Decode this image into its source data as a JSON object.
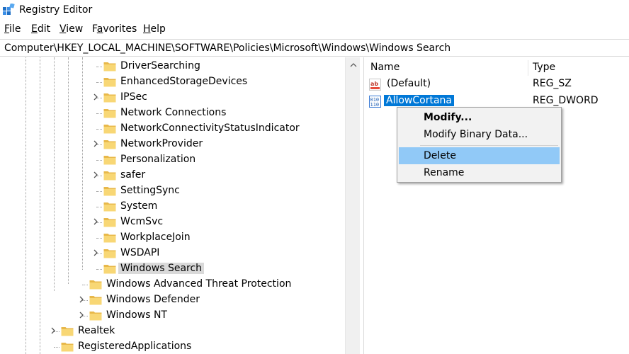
{
  "window": {
    "title": "Registry Editor",
    "icon": "registry-editor-icon"
  },
  "menu": [
    {
      "label": "File",
      "mnemonic": "F",
      "rest": "ile"
    },
    {
      "label": "Edit",
      "mnemonic": "E",
      "rest": "dit"
    },
    {
      "label": "View",
      "mnemonic": "V",
      "rest": "iew"
    },
    {
      "label": "Favorites",
      "mnemonic": "a",
      "prefix": "F",
      "rest": "vorites"
    },
    {
      "label": "Help",
      "mnemonic": "H",
      "rest": "elp"
    }
  ],
  "address": "Computer\\HKEY_LOCAL_MACHINE\\SOFTWARE\\Policies\\Microsoft\\Windows\\Windows Search",
  "tree": [
    {
      "label": "DriverSearching",
      "level": 3,
      "expandable": false
    },
    {
      "label": "EnhancedStorageDevices",
      "level": 3,
      "expandable": false
    },
    {
      "label": "IPSec",
      "level": 3,
      "expandable": true
    },
    {
      "label": "Network Connections",
      "level": 3,
      "expandable": false
    },
    {
      "label": "NetworkConnectivityStatusIndicator",
      "level": 3,
      "expandable": false
    },
    {
      "label": "NetworkProvider",
      "level": 3,
      "expandable": true
    },
    {
      "label": "Personalization",
      "level": 3,
      "expandable": false
    },
    {
      "label": "safer",
      "level": 3,
      "expandable": true
    },
    {
      "label": "SettingSync",
      "level": 3,
      "expandable": false
    },
    {
      "label": "System",
      "level": 3,
      "expandable": false
    },
    {
      "label": "WcmSvc",
      "level": 3,
      "expandable": true
    },
    {
      "label": "WorkplaceJoin",
      "level": 3,
      "expandable": false
    },
    {
      "label": "WSDAPI",
      "level": 3,
      "expandable": true
    },
    {
      "label": "Windows Search",
      "level": 3,
      "expandable": false,
      "selected": true
    },
    {
      "label": "Windows Advanced Threat Protection",
      "level": 2,
      "expandable": false
    },
    {
      "label": "Windows Defender",
      "level": 2,
      "expandable": true
    },
    {
      "label": "Windows NT",
      "level": 2,
      "expandable": true
    },
    {
      "label": "Realtek",
      "level": 1,
      "expandable": true
    },
    {
      "label": "RegisteredApplications",
      "level": 1,
      "expandable": false
    }
  ],
  "list": {
    "columns": {
      "name": "Name",
      "type": "Type"
    },
    "rows": [
      {
        "name": "(Default)",
        "type": "REG_SZ",
        "icon": "string-value-icon",
        "selected": false
      },
      {
        "name": "AllowCortana",
        "type": "REG_DWORD",
        "icon": "binary-value-icon",
        "selected": true
      }
    ]
  },
  "context_menu": {
    "items": [
      {
        "label": "Modify...",
        "bold": true,
        "hover": false
      },
      {
        "label": "Modify Binary Data...",
        "bold": false,
        "hover": false
      },
      {
        "label": "Delete",
        "bold": false,
        "hover": true
      },
      {
        "label": "Rename",
        "bold": false,
        "hover": false
      }
    ]
  },
  "colors": {
    "folder": "#f8d775",
    "selection_blue": "#0078d7",
    "menu_hover": "#91c9f7",
    "tree_selected": "#d9d9d9"
  }
}
